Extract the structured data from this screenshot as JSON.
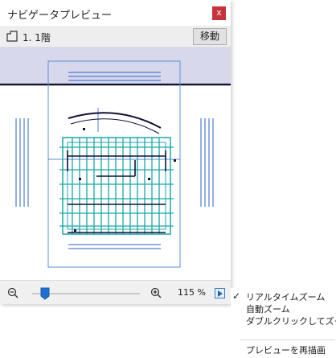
{
  "window": {
    "title": "ナビゲータプレビュー",
    "close_label": "x"
  },
  "story": {
    "label": "1. 1階",
    "move_button": "移動"
  },
  "zoom": {
    "value_label": "115 %",
    "slider_level": 0.12
  },
  "menu": {
    "items": [
      {
        "label": "リアルタイムズーム",
        "checked": true
      },
      {
        "label": "自動ズーム",
        "checked": false
      },
      {
        "label": "ダブルクリックしてズーム",
        "checked": false
      },
      {
        "label": "プレビューを再描画",
        "checked": false
      }
    ],
    "check_glyph": "✓"
  },
  "colors": {
    "close_button": "#c8323c",
    "view_band": "#d8d8ec",
    "view_frame": "#5b8fd6",
    "building_cyan": "#19a8a8",
    "drawing_blue": "#2a62c8",
    "dark_line": "#101038"
  }
}
